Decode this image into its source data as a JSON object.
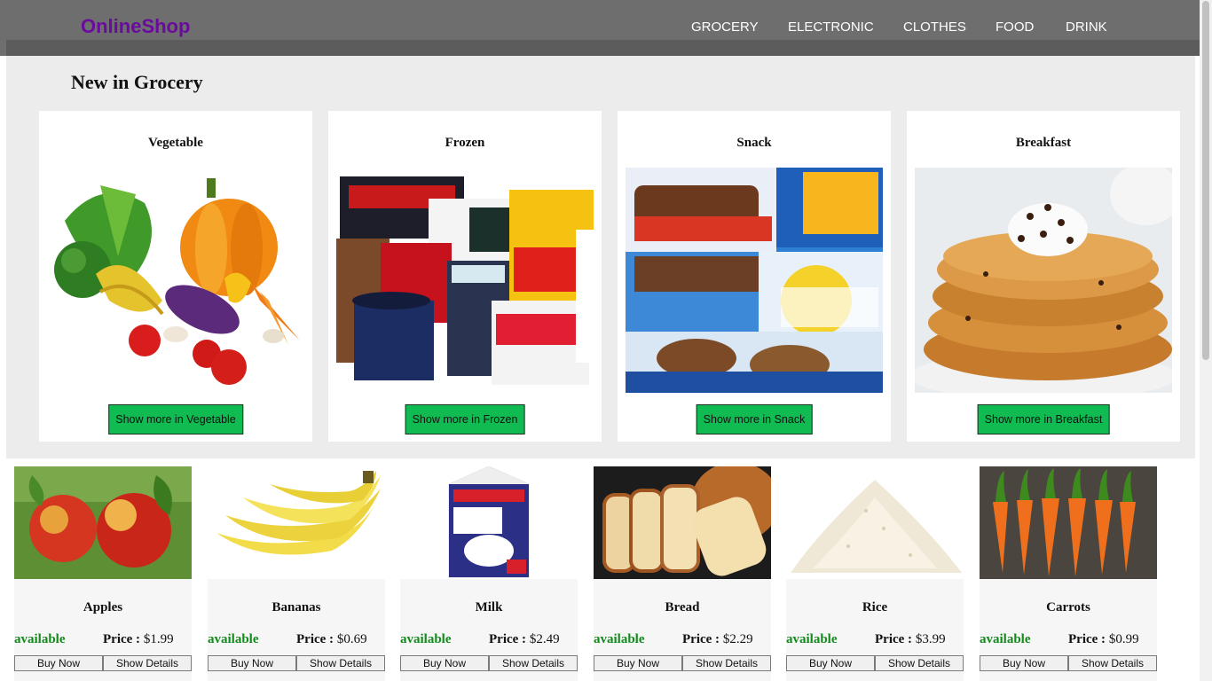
{
  "header": {
    "logo": "OnlineShop",
    "nav": [
      "GROCERY",
      "ELECTRONIC",
      "CLOTHES",
      "FOOD",
      "DRINK"
    ]
  },
  "grocery": {
    "title": "New in Grocery",
    "categories": [
      {
        "title": "Vegetable",
        "button": "Show more in Vegetable",
        "image_icon": "vegetables-image"
      },
      {
        "title": "Frozen",
        "button": "Show more in Frozen",
        "image_icon": "frozen-foods-image"
      },
      {
        "title": "Snack",
        "button": "Show more in Snack",
        "image_icon": "snacks-image"
      },
      {
        "title": "Breakfast",
        "button": "Show more in Breakfast",
        "image_icon": "pancakes-image"
      }
    ]
  },
  "products": [
    {
      "name": "Apples",
      "status": "available",
      "price_label": "Price :",
      "price": "$1.99",
      "buy": "Buy Now",
      "details": "Show Details"
    },
    {
      "name": "Bananas",
      "status": "available",
      "price_label": "Price :",
      "price": "$0.69",
      "buy": "Buy Now",
      "details": "Show Details"
    },
    {
      "name": "Milk",
      "status": "available",
      "price_label": "Price :",
      "price": "$2.49",
      "buy": "Buy Now",
      "details": "Show Details"
    },
    {
      "name": "Bread",
      "status": "available",
      "price_label": "Price :",
      "price": "$2.29",
      "buy": "Buy Now",
      "details": "Show Details"
    },
    {
      "name": "Rice",
      "status": "available",
      "price_label": "Price :",
      "price": "$3.99",
      "buy": "Buy Now",
      "details": "Show Details"
    },
    {
      "name": "Carrots",
      "status": "available",
      "price_label": "Price :",
      "price": "$0.99",
      "buy": "Buy Now",
      "details": "Show Details"
    }
  ],
  "colors": {
    "navbar": "#6e6e6e",
    "logo": "#6a0a9e",
    "button_green": "#10bb52",
    "available_green": "#128a1c",
    "section_bg": "#ececec"
  }
}
